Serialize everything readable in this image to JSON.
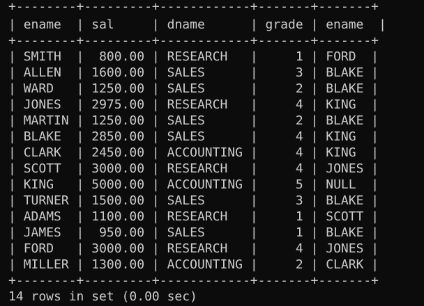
{
  "terminal": {
    "colors": {
      "background": "#0c0c0c",
      "foreground": "#cccccc"
    },
    "columns": [
      "ename",
      "sal",
      "dname",
      "grade",
      "ename"
    ],
    "rows": [
      [
        "SMITH",
        "800.00",
        "RESEARCH",
        "1",
        "FORD"
      ],
      [
        "ALLEN",
        "1600.00",
        "SALES",
        "3",
        "BLAKE"
      ],
      [
        "WARD",
        "1250.00",
        "SALES",
        "2",
        "BLAKE"
      ],
      [
        "JONES",
        "2975.00",
        "RESEARCH",
        "4",
        "KING"
      ],
      [
        "MARTIN",
        "1250.00",
        "SALES",
        "2",
        "BLAKE"
      ],
      [
        "BLAKE",
        "2850.00",
        "SALES",
        "4",
        "KING"
      ],
      [
        "CLARK",
        "2450.00",
        "ACCOUNTING",
        "4",
        "KING"
      ],
      [
        "SCOTT",
        "3000.00",
        "RESEARCH",
        "4",
        "JONES"
      ],
      [
        "KING",
        "5000.00",
        "ACCOUNTING",
        "5",
        "NULL"
      ],
      [
        "TURNER",
        "1500.00",
        "SALES",
        "3",
        "BLAKE"
      ],
      [
        "ADAMS",
        "1100.00",
        "RESEARCH",
        "1",
        "SCOTT"
      ],
      [
        "JAMES",
        "950.00",
        "SALES",
        "1",
        "BLAKE"
      ],
      [
        "FORD",
        "3000.00",
        "RESEARCH",
        "4",
        "JONES"
      ],
      [
        "MILLER",
        "1300.00",
        "ACCOUNTING",
        "2",
        "CLARK"
      ]
    ],
    "status": "14 rows in set (0.00 sec)"
  }
}
